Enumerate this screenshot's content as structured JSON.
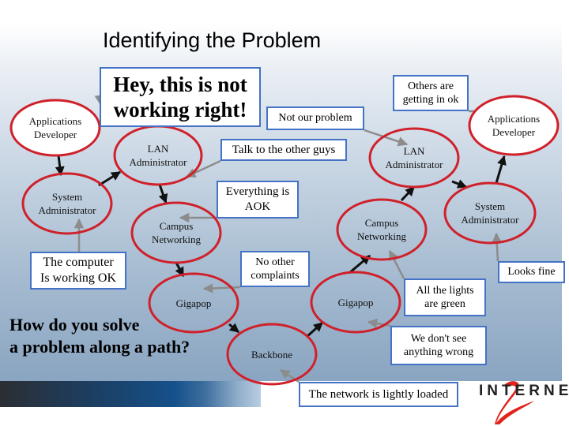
{
  "slide": {
    "title": "Identifying the Problem",
    "question_line1": "How do you solve",
    "question_line2": "a problem along a path?",
    "colors": {
      "ellipse_stroke": "#d0202a",
      "callout_border": "#4472c4",
      "path_arrow": "#111111",
      "callout_arrow": "#8c8c8c",
      "logo_red": "#e0231c"
    },
    "nodes": [
      {
        "id": "app-dev-left",
        "line1": "Applications",
        "line2": "Developer",
        "filled": true
      },
      {
        "id": "sys-admin-left",
        "line1": "System",
        "line2": "Administrator",
        "filled": false
      },
      {
        "id": "lan-admin-left",
        "line1": "LAN",
        "line2": "Administrator",
        "filled": false
      },
      {
        "id": "campus-left",
        "line1": "Campus",
        "line2": "Networking",
        "filled": false
      },
      {
        "id": "gigapop-left",
        "line1": "Gigapop",
        "line2": "",
        "filled": false
      },
      {
        "id": "backbone",
        "line1": "Backbone",
        "line2": "",
        "filled": false
      },
      {
        "id": "gigapop-right",
        "line1": "Gigapop",
        "line2": "",
        "filled": false
      },
      {
        "id": "campus-right",
        "line1": "Campus",
        "line2": "Networking",
        "filled": false
      },
      {
        "id": "lan-admin-right",
        "line1": "LAN",
        "line2": "Administrator",
        "filled": false
      },
      {
        "id": "sys-admin-right",
        "line1": "System",
        "line2": "Administrator",
        "filled": false
      },
      {
        "id": "app-dev-right",
        "line1": "Applications",
        "line2": "Developer",
        "filled": true
      }
    ],
    "callouts": [
      {
        "id": "hey-not-working",
        "text": "Hey, this is not\nworking right!",
        "points_to": "app-dev-left"
      },
      {
        "id": "computer-ok",
        "text": "The computer\nIs working OK",
        "points_to": "sys-admin-left"
      },
      {
        "id": "talk-other-guys",
        "text": "Talk to the other guys",
        "points_to": "lan-admin-left"
      },
      {
        "id": "everything-aok",
        "text": "Everything is\nAOK",
        "points_to": "campus-left"
      },
      {
        "id": "no-other-complaints",
        "text": "No other\ncomplaints",
        "points_to": "gigapop-left"
      },
      {
        "id": "network-lightly-loaded",
        "text": "The network is lightly loaded",
        "points_to": "backbone"
      },
      {
        "id": "dont-see-wrong",
        "text": "We don't see\nanything wrong",
        "points_to": "gigapop-right"
      },
      {
        "id": "lights-green",
        "text": "All the lights\nare green",
        "points_to": "campus-right"
      },
      {
        "id": "not-our-problem",
        "text": "Not our problem",
        "points_to": "lan-admin-right"
      },
      {
        "id": "looks-fine",
        "text": "Looks fine",
        "points_to": "sys-admin-right"
      },
      {
        "id": "others-getting-in",
        "text": "Others are\ngetting in ok",
        "points_to": "app-dev-right"
      }
    ],
    "logo": {
      "text": "INTERNET",
      "mark": "2",
      "registered": "®"
    }
  }
}
